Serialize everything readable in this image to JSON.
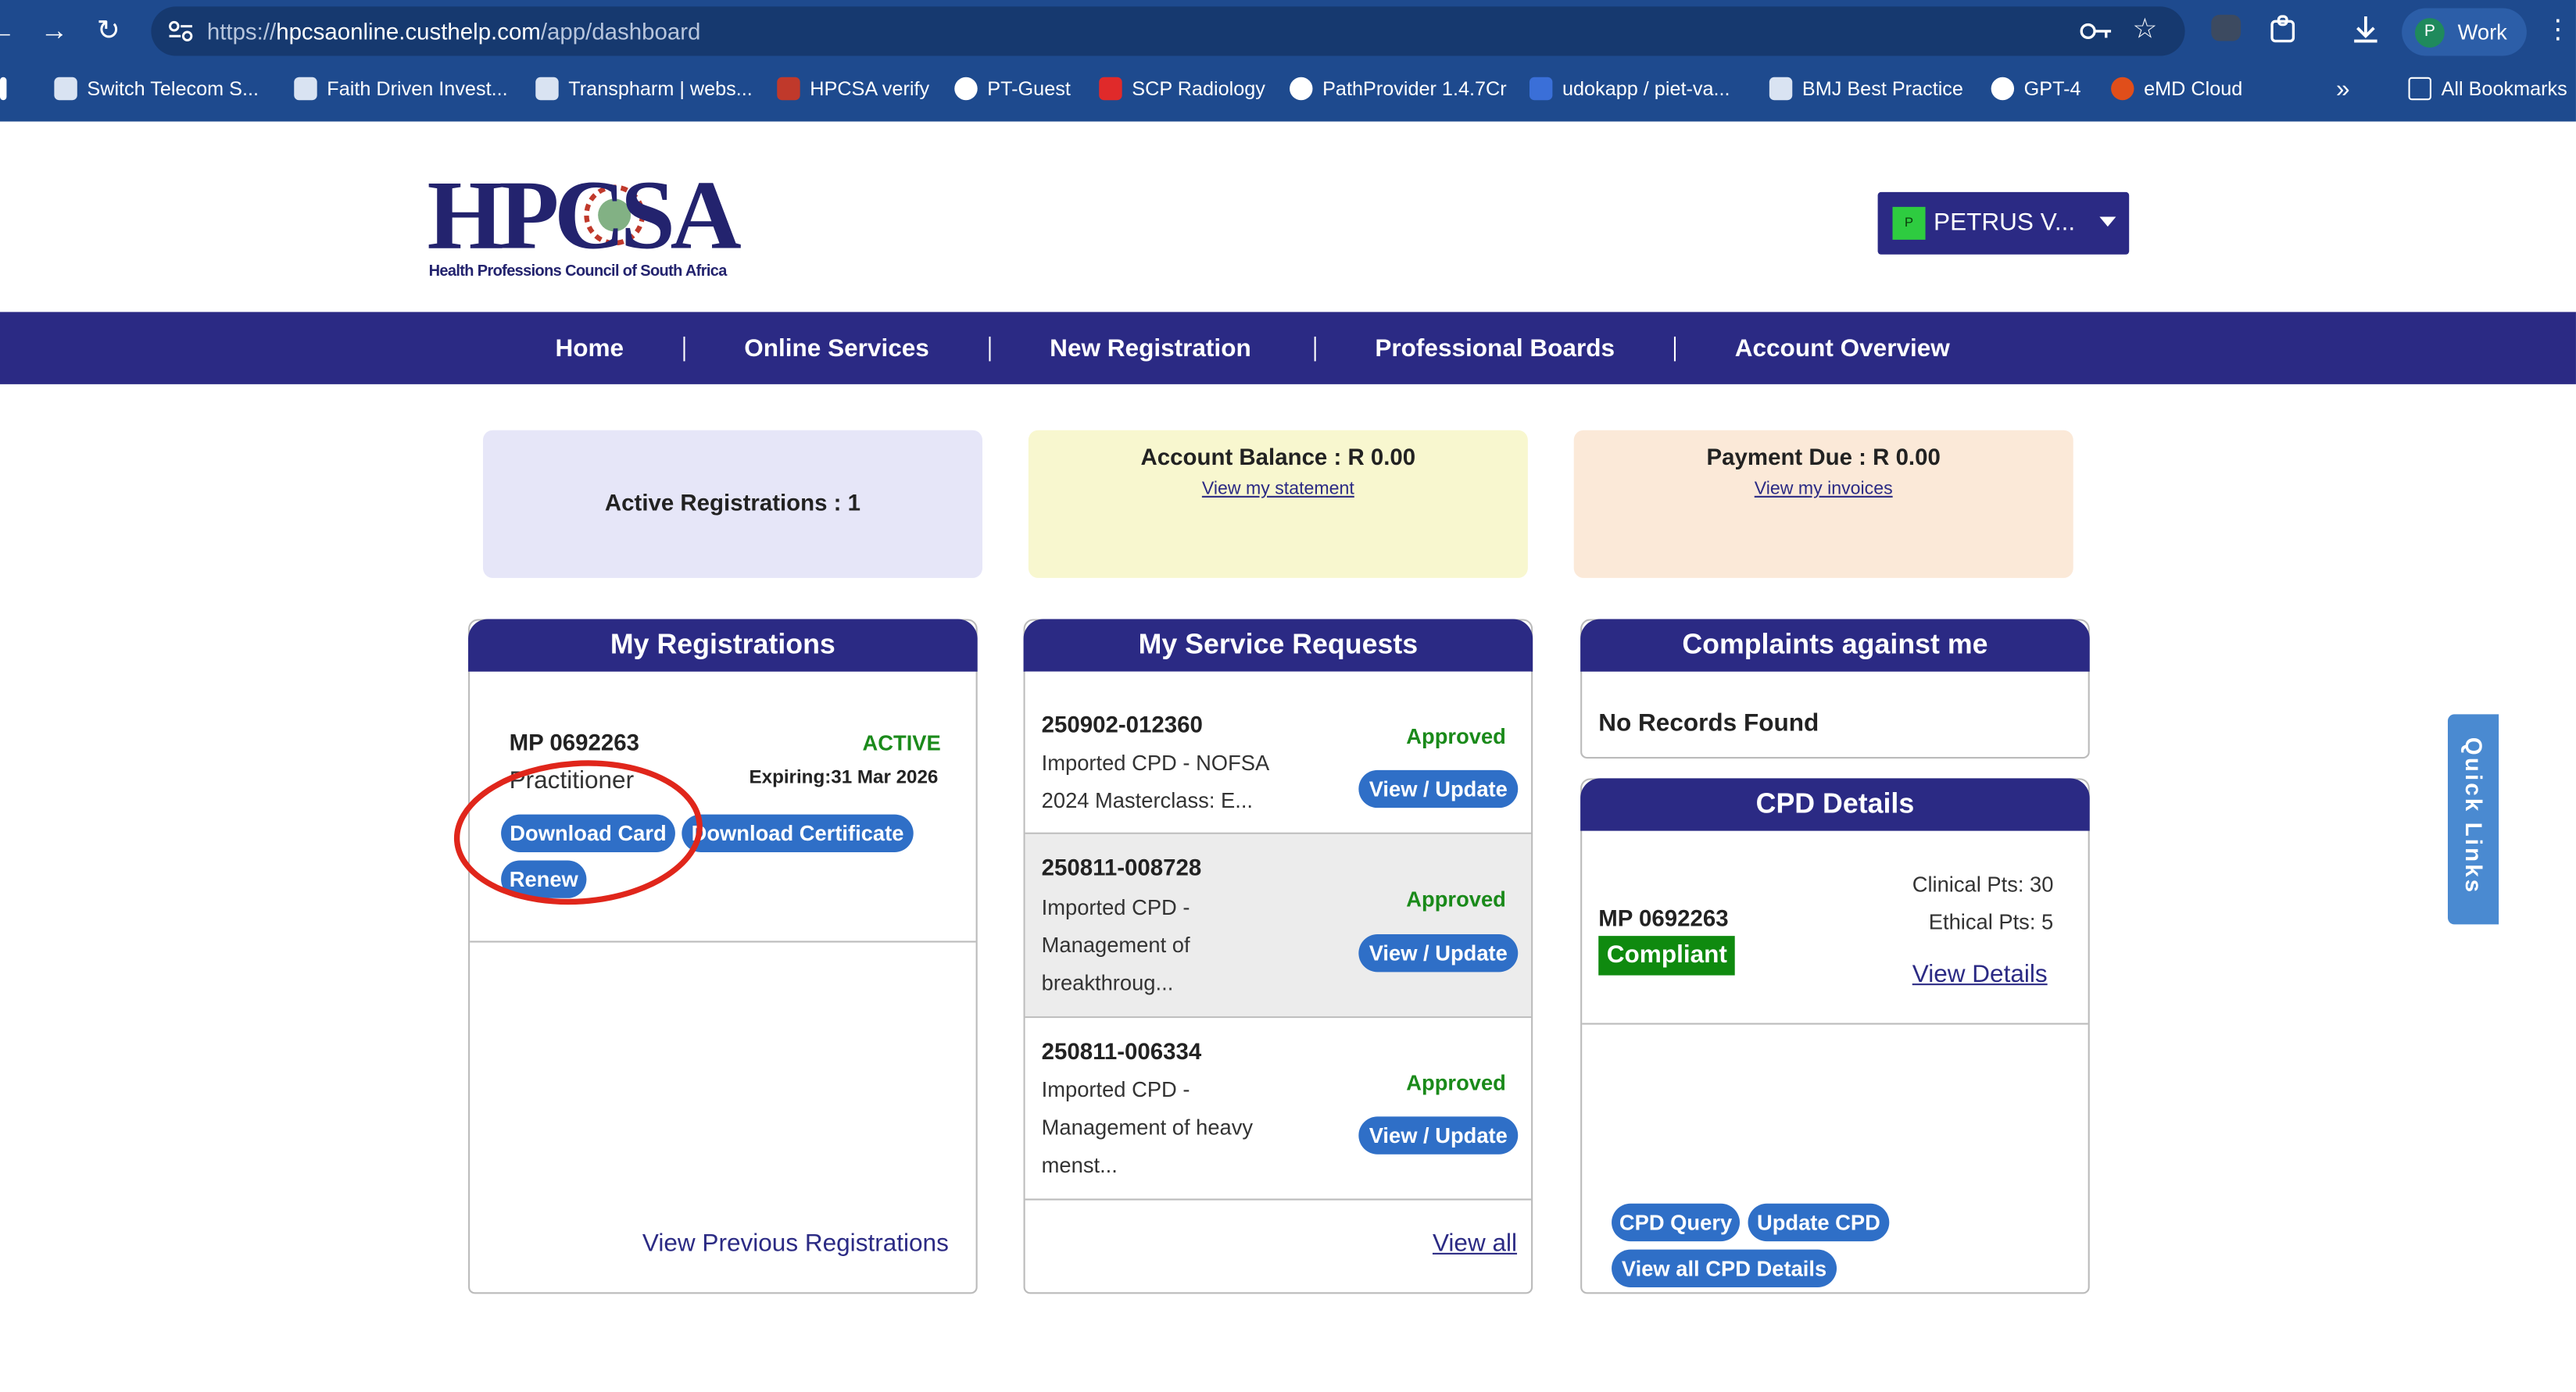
{
  "browser": {
    "url_prefix": "https://",
    "url_host": "hpcsaonline.custhelp.com",
    "url_path": "/app/dashboard",
    "bookmarks": [
      "Switch Telecom S...",
      "Faith Driven Invest...",
      "Transpharm | webs...",
      "HPCSA verify",
      "PT-Guest",
      "SCP Radiology",
      "PathProvider 1.4.7Cr",
      "udokapp / piet-va...",
      "BMJ Best Practice",
      "GPT-4",
      "eMD Cloud"
    ],
    "overflow": "»",
    "all_bookmarks": "All Bookmarks",
    "profile_initial": "P",
    "profile_label": "Work"
  },
  "header": {
    "logo_text": "HPCSA",
    "logo_subtitle": "Health Professions Council of South Africa",
    "user_initial": "P",
    "user_name": "PETRUS V..."
  },
  "nav": [
    "Home",
    "Online Services",
    "New Registration",
    "Professional Boards",
    "Account Overview"
  ],
  "summary": {
    "active_registrations": "Active Registrations : 1",
    "account_balance": "Account Balance : R 0.00",
    "view_statement": "View my statement",
    "payment_due": "Payment Due : R 0.00",
    "view_invoices": "View my invoices"
  },
  "registrations": {
    "title": "My Registrations",
    "number": "MP 0692263",
    "status": "ACTIVE",
    "type": "Practitioner",
    "expiry": "Expiring:31 Mar 2026",
    "download_card": "Download Card",
    "download_certificate": "Download Certificate",
    "renew": "Renew",
    "view_previous": "View Previous Registrations"
  },
  "service_requests": {
    "title": "My Service Requests",
    "items": [
      {
        "id": "250902-012360",
        "status": "Approved",
        "line1": "Imported CPD - NOFSA",
        "line2": "2024 Masterclass: E...",
        "line3": ""
      },
      {
        "id": "250811-008728",
        "status": "Approved",
        "line1": "Imported CPD -",
        "line2": "Management of",
        "line3": "breakthroug..."
      },
      {
        "id": "250811-006334",
        "status": "Approved",
        "line1": "Imported CPD -",
        "line2": "Management of heavy",
        "line3": "menst..."
      }
    ],
    "action_label": "View / Update",
    "view_all": "View all"
  },
  "complaints": {
    "title": "Complaints against me",
    "empty": "No Records Found"
  },
  "cpd": {
    "title": "CPD Details",
    "clinical": "Clinical Pts: 30",
    "ethical": "Ethical Pts: 5",
    "number": "MP 0692263",
    "status": "Compliant",
    "view_details": "View Details",
    "query": "CPD Query",
    "update": "Update CPD",
    "view_all": "View all CPD Details"
  },
  "quick_links": "Quick Links",
  "colors": {
    "brand_navy": "#2b2a84",
    "button_blue": "#2f6fc7",
    "approved_green": "#1a8a1a",
    "compliant_bg": "#0f8a0f",
    "annotation_red": "#e0261b"
  }
}
